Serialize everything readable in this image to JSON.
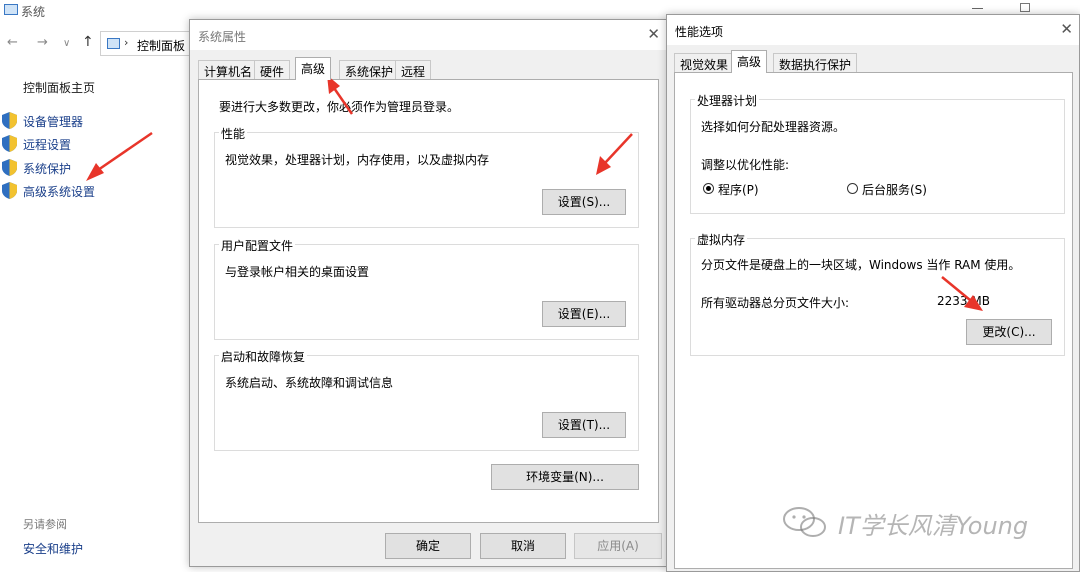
{
  "background_window": {
    "title": "系统",
    "address": "控制面板",
    "control_panel_home": "控制面板主页",
    "links": [
      "设备管理器",
      "远程设置",
      "系统保护",
      "高级系统设置"
    ],
    "see_also": "另请参阅",
    "security_maintenance": "安全和维护"
  },
  "system_properties": {
    "title": "系统属性",
    "tabs": [
      "计算机名",
      "硬件",
      "高级",
      "系统保护",
      "远程"
    ],
    "admin_note": "要进行大多数更改，你必须作为管理员登录。",
    "performance": {
      "title": "性能",
      "description": "视觉效果，处理器计划，内存使用，以及虚拟内存",
      "button": "设置(S)..."
    },
    "user_profiles": {
      "title": "用户配置文件",
      "description": "与登录帐户相关的桌面设置",
      "button": "设置(E)..."
    },
    "startup_recovery": {
      "title": "启动和故障恢复",
      "description": "系统启动、系统故障和调试信息",
      "button": "设置(T)..."
    },
    "env_button": "环境变量(N)...",
    "ok": "确定",
    "cancel": "取消",
    "apply": "应用(A)"
  },
  "performance_options": {
    "title": "性能选项",
    "tabs": [
      "视觉效果",
      "高级",
      "数据执行保护"
    ],
    "processor_scheduling": {
      "title": "处理器计划",
      "description": "选择如何分配处理器资源。",
      "adjust_label": "调整以优化性能:",
      "option_programs": "程序(P)",
      "option_background": "后台服务(S)",
      "selected": "程序(P)"
    },
    "virtual_memory": {
      "title": "虚拟内存",
      "description": "分页文件是硬盘上的一块区域，Windows 当作 RAM 使用。",
      "total_label": "所有驱动器总分页文件大小:",
      "total_value": "2233 MB",
      "change_button": "更改(C)..."
    }
  },
  "watermark": "IT学长风清Young",
  "colors": {
    "arrow": "#e8352a",
    "link": "#1a3f8a",
    "dialog_bg": "#f0f0f0"
  },
  "icons": [
    "computer-icon",
    "shield-icon",
    "close-icon",
    "radio-icon",
    "wechat-icon"
  ]
}
